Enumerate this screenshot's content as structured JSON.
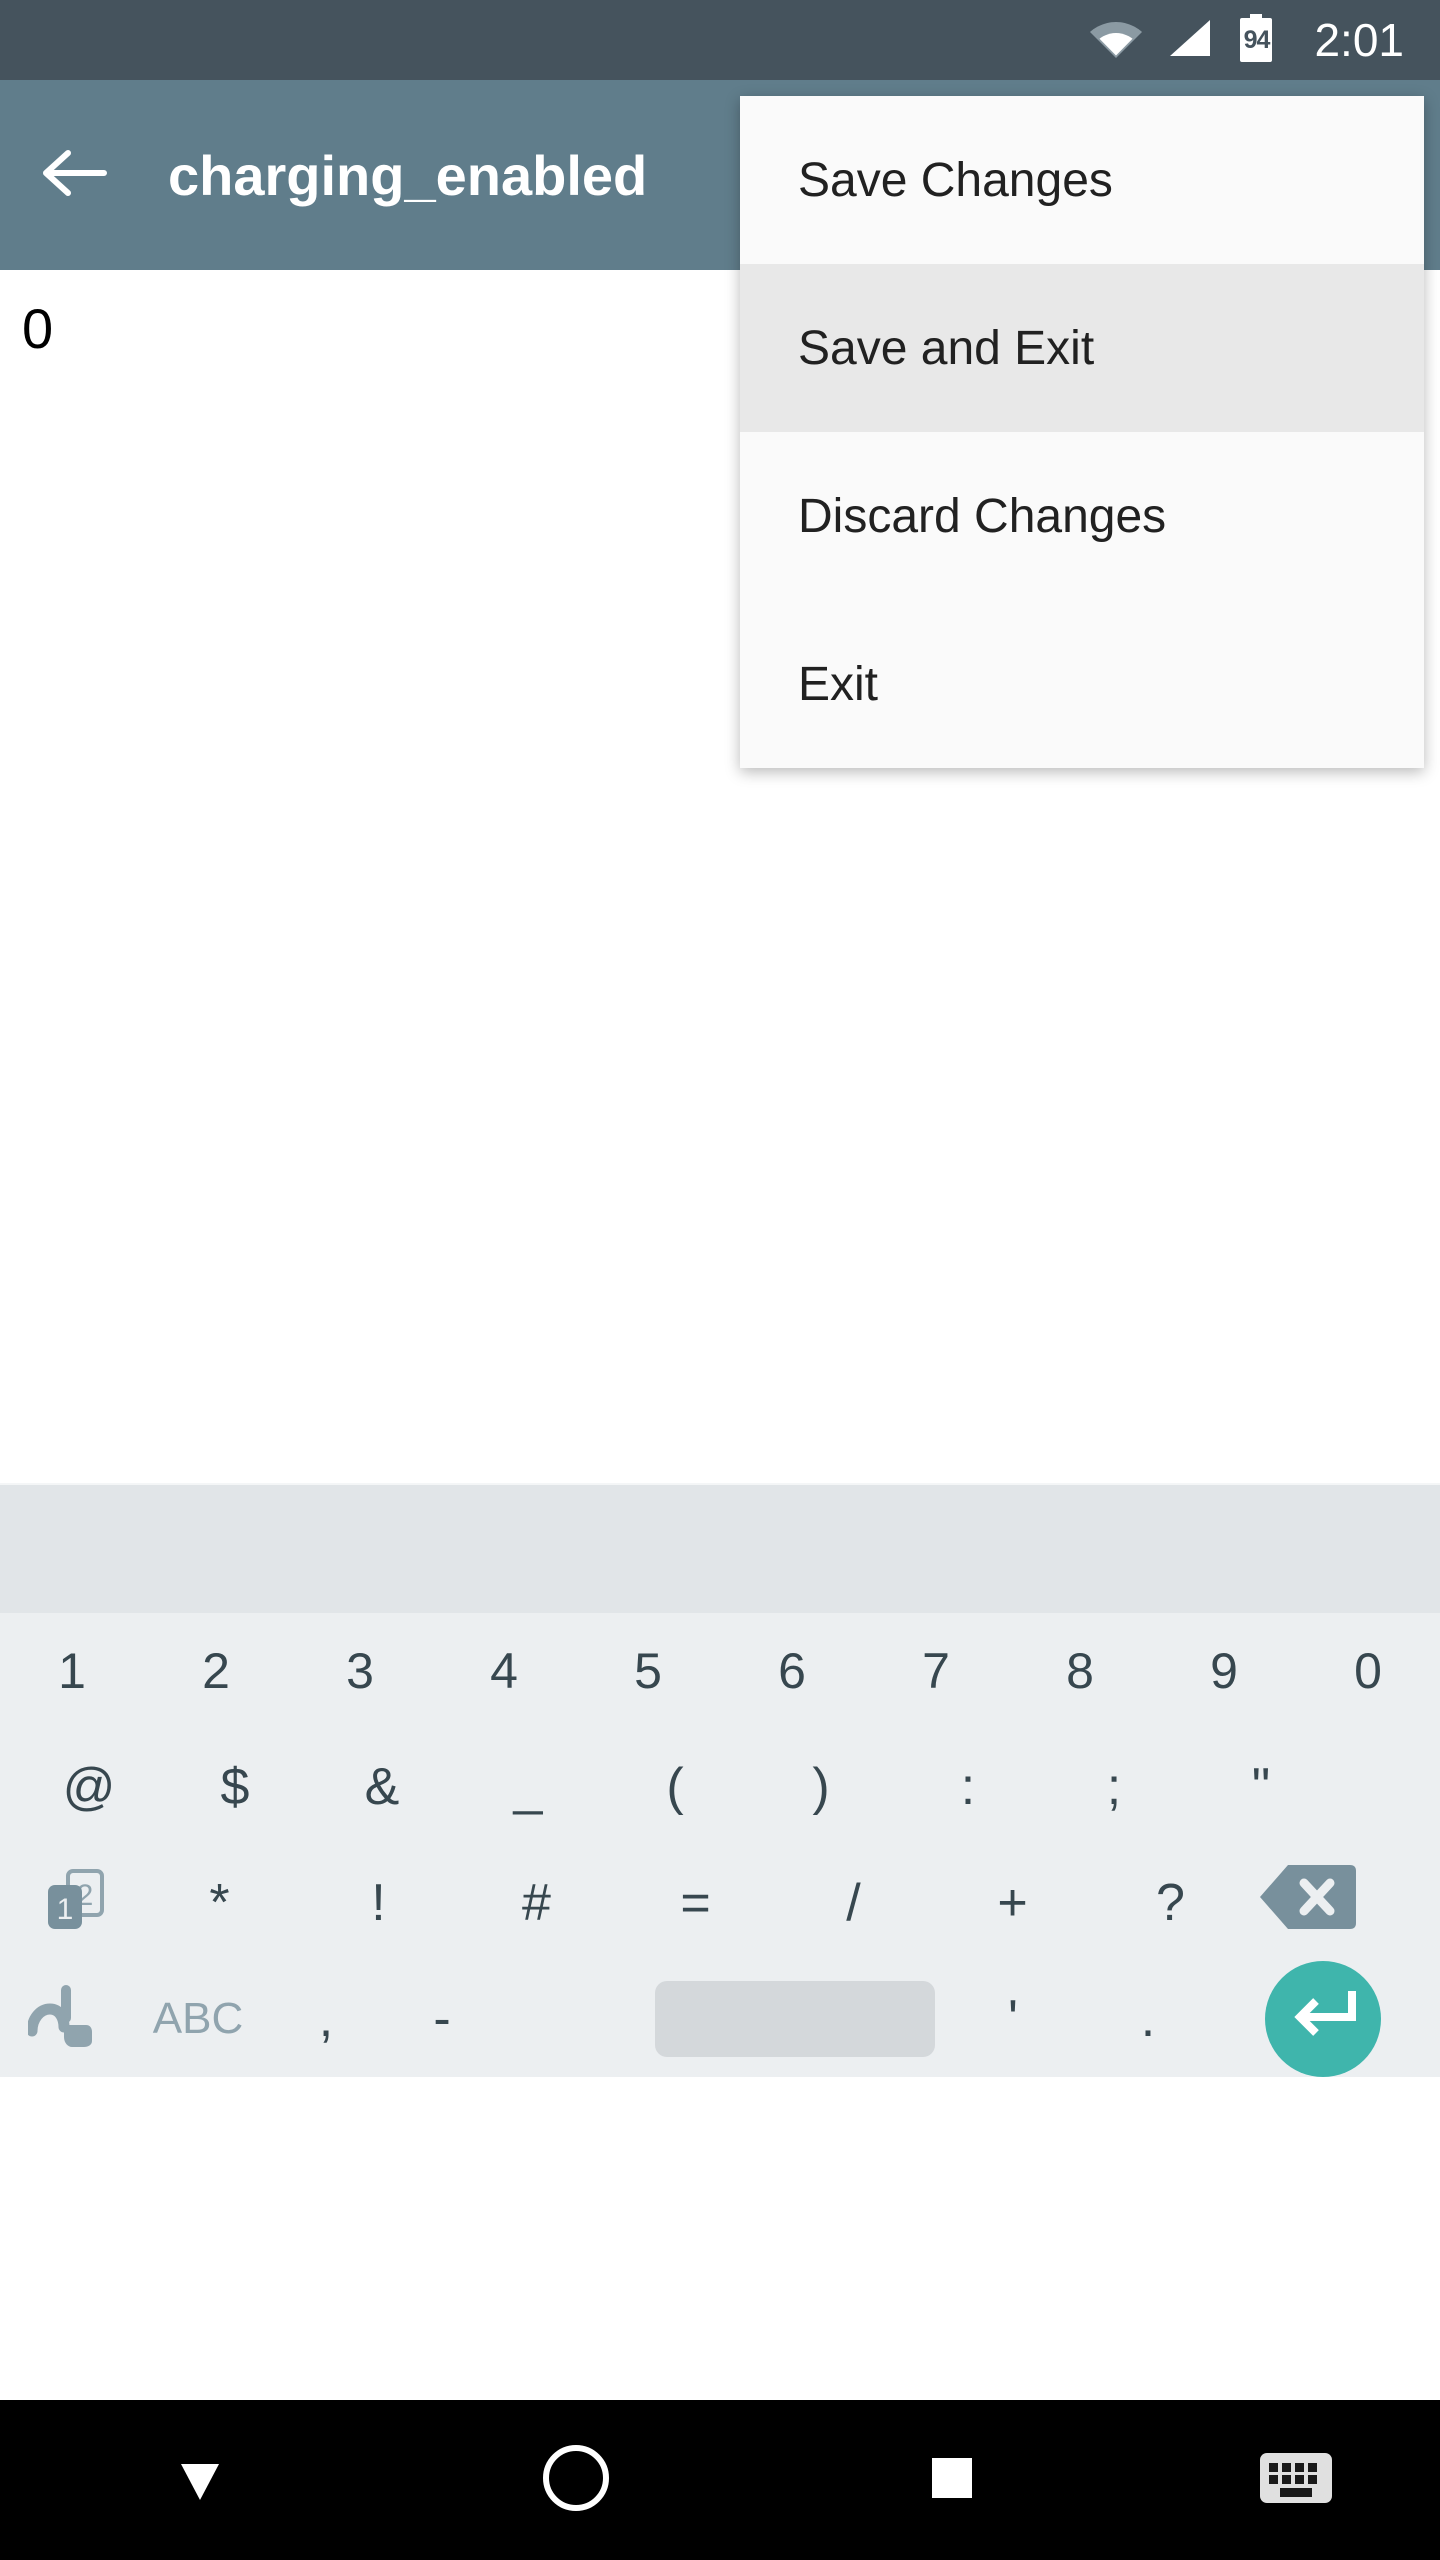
{
  "status_bar": {
    "time": "2:01",
    "battery_level": "94",
    "wifi_icon": "wifi-icon",
    "signal_icon": "signal-icon",
    "battery_icon": "battery-icon",
    "background_color": "#45535d"
  },
  "app_bar": {
    "back_icon": "back-arrow-icon",
    "title": "charging_enabled",
    "background_color": "#607d8b"
  },
  "content": {
    "edit_value": "0"
  },
  "overflow_menu": {
    "items": [
      {
        "label": "Save Changes",
        "pressed": false
      },
      {
        "label": "Save and Exit",
        "pressed": true
      },
      {
        "label": "Discard Changes",
        "pressed": false
      },
      {
        "label": "Exit",
        "pressed": false
      }
    ],
    "background_color": "#fafafa",
    "pressed_color": "#e8e8e8"
  },
  "keyboard": {
    "background_color": "#eceff1",
    "suggestion_strip_color": "#e1e5e8",
    "key_text_color": "#37474f",
    "enter_key_color": "#3fb5ac",
    "space_key_color": "#d4d8db",
    "row1": [
      {
        "label": "1",
        "name": "key-1"
      },
      {
        "label": "2",
        "name": "key-2"
      },
      {
        "label": "3",
        "name": "key-3"
      },
      {
        "label": "4",
        "name": "key-4"
      },
      {
        "label": "5",
        "name": "key-5"
      },
      {
        "label": "6",
        "name": "key-6"
      },
      {
        "label": "7",
        "name": "key-7"
      },
      {
        "label": "8",
        "name": "key-8"
      },
      {
        "label": "9",
        "name": "key-9"
      },
      {
        "label": "0",
        "name": "key-0"
      }
    ],
    "row2": [
      {
        "label": "@",
        "name": "key-at"
      },
      {
        "label": "$",
        "name": "key-dollar"
      },
      {
        "label": "&",
        "name": "key-ampersand"
      },
      {
        "label": "_",
        "name": "key-underscore"
      },
      {
        "label": "(",
        "name": "key-left-paren"
      },
      {
        "label": ")",
        "name": "key-right-paren"
      },
      {
        "label": ":",
        "name": "key-colon"
      },
      {
        "label": ";",
        "name": "key-semicolon"
      },
      {
        "label": "\"",
        "name": "key-quote"
      }
    ],
    "row3": [
      {
        "label": "*",
        "name": "key-asterisk"
      },
      {
        "label": "!",
        "name": "key-exclamation"
      },
      {
        "label": "#",
        "name": "key-hash"
      },
      {
        "label": "=",
        "name": "key-equals"
      },
      {
        "label": "/",
        "name": "key-slash"
      },
      {
        "label": "+",
        "name": "key-plus"
      },
      {
        "label": "?",
        "name": "key-question"
      }
    ],
    "row3_symbol_switch_icon": "symbol-page-switch-icon",
    "row3_backspace_icon": "backspace-icon",
    "row4": {
      "gesture_icon": "gesture-input-icon",
      "abc_label": "ABC",
      "comma_label": ",",
      "hyphen_label": "-",
      "space_label": "",
      "apostrophe_label": "'",
      "period_label": ".",
      "enter_icon": "enter-icon"
    }
  },
  "nav_bar": {
    "background_color": "#000000",
    "back_icon": "collapse-keyboard-icon",
    "home_icon": "home-icon",
    "recents_icon": "recents-icon",
    "keyboard_switch_icon": "keyboard-switcher-icon"
  }
}
